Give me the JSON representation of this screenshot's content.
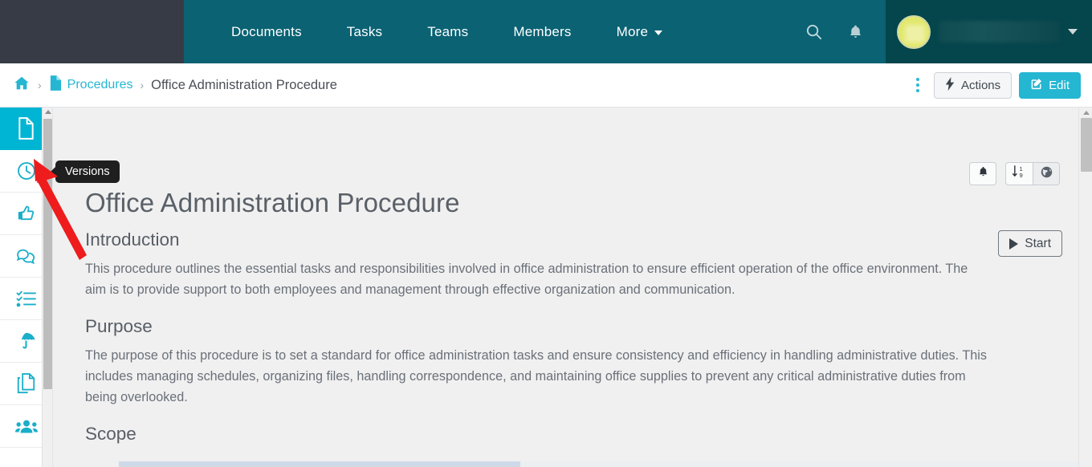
{
  "topnav": {
    "links": [
      {
        "label": "Documents",
        "icon": ""
      },
      {
        "label": "Tasks",
        "icon": ""
      },
      {
        "label": "Teams",
        "icon": ""
      },
      {
        "label": "Members",
        "icon": ""
      },
      {
        "label": "More",
        "icon": "chevron-down-icon"
      }
    ],
    "search_icon": "search-icon",
    "bell_icon": "bell-icon",
    "user_caret_icon": "chevron-down-icon",
    "brand_dark": "#363b45",
    "brand_teal": "#0a6273",
    "brand_teal_dark": "#05454c"
  },
  "breadcrumb": {
    "home_icon": "home-icon",
    "doc_icon": "file-icon",
    "sep": "›",
    "parent": "Procedures",
    "current": "Office Administration Procedure",
    "kebab_icon": "kebab-menu-icon",
    "actions_label": "Actions",
    "actions_icon": "lightning-bolt-icon",
    "edit_label": "Edit",
    "edit_icon": "pencil-square-icon",
    "edit_color": "#25b6d2"
  },
  "sidebar": {
    "items": [
      {
        "icon": "document-icon",
        "name": "document",
        "active": true
      },
      {
        "icon": "clock-icon",
        "name": "versions",
        "active": false
      },
      {
        "icon": "thumbs-up-icon",
        "name": "approvals",
        "active": false
      },
      {
        "icon": "comments-icon",
        "name": "comments",
        "active": false
      },
      {
        "icon": "checklist-icon",
        "name": "tasks",
        "active": false
      },
      {
        "icon": "umbrella-icon",
        "name": "risks",
        "active": false
      },
      {
        "icon": "copy-icon",
        "name": "copies",
        "active": false
      },
      {
        "icon": "people-icon",
        "name": "people",
        "active": false
      }
    ]
  },
  "tooltip": {
    "label": "Versions"
  },
  "doc_toolbar": {
    "bell_icon": "bell-icon",
    "sort_icon": "sort-numeric-icon",
    "globe_icon": "globe-icon",
    "start_label": "Start",
    "start_icon": "play-icon"
  },
  "document": {
    "title": "Office Administration Procedure",
    "sections": [
      {
        "heading": "Introduction",
        "body": "This procedure outlines the essential tasks and responsibilities involved in office administration to ensure efficient operation of the office environment. The aim is to provide support to both employees and management through effective organization and communication."
      },
      {
        "heading": "Purpose",
        "body": "The purpose of this procedure is to set a standard for office administration tasks and ensure consistency and efficiency in handling administrative duties. This includes managing schedules, organizing files, handling correspondence, and maintaining office supplies to prevent any critical administrative duties from being overlooked."
      },
      {
        "heading": "Scope",
        "body": ""
      }
    ]
  }
}
